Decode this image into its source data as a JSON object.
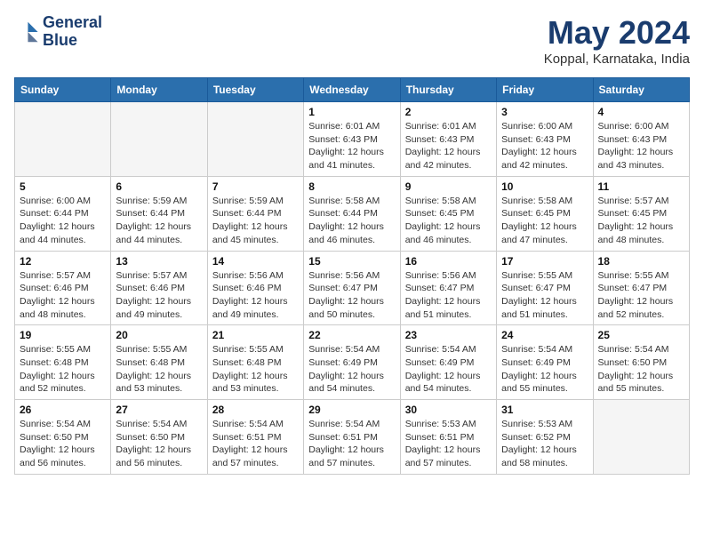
{
  "header": {
    "logo_line1": "General",
    "logo_line2": "Blue",
    "month_year": "May 2024",
    "location": "Koppal, Karnataka, India"
  },
  "days_of_week": [
    "Sunday",
    "Monday",
    "Tuesday",
    "Wednesday",
    "Thursday",
    "Friday",
    "Saturday"
  ],
  "weeks": [
    [
      {
        "day": "",
        "empty": true
      },
      {
        "day": "",
        "empty": true
      },
      {
        "day": "",
        "empty": true
      },
      {
        "day": "1",
        "sunrise": "6:01 AM",
        "sunset": "6:43 PM",
        "daylight": "12 hours and 41 minutes."
      },
      {
        "day": "2",
        "sunrise": "6:01 AM",
        "sunset": "6:43 PM",
        "daylight": "12 hours and 42 minutes."
      },
      {
        "day": "3",
        "sunrise": "6:00 AM",
        "sunset": "6:43 PM",
        "daylight": "12 hours and 42 minutes."
      },
      {
        "day": "4",
        "sunrise": "6:00 AM",
        "sunset": "6:43 PM",
        "daylight": "12 hours and 43 minutes."
      }
    ],
    [
      {
        "day": "5",
        "sunrise": "6:00 AM",
        "sunset": "6:44 PM",
        "daylight": "12 hours and 44 minutes."
      },
      {
        "day": "6",
        "sunrise": "5:59 AM",
        "sunset": "6:44 PM",
        "daylight": "12 hours and 44 minutes."
      },
      {
        "day": "7",
        "sunrise": "5:59 AM",
        "sunset": "6:44 PM",
        "daylight": "12 hours and 45 minutes."
      },
      {
        "day": "8",
        "sunrise": "5:58 AM",
        "sunset": "6:44 PM",
        "daylight": "12 hours and 46 minutes."
      },
      {
        "day": "9",
        "sunrise": "5:58 AM",
        "sunset": "6:45 PM",
        "daylight": "12 hours and 46 minutes."
      },
      {
        "day": "10",
        "sunrise": "5:58 AM",
        "sunset": "6:45 PM",
        "daylight": "12 hours and 47 minutes."
      },
      {
        "day": "11",
        "sunrise": "5:57 AM",
        "sunset": "6:45 PM",
        "daylight": "12 hours and 48 minutes."
      }
    ],
    [
      {
        "day": "12",
        "sunrise": "5:57 AM",
        "sunset": "6:46 PM",
        "daylight": "12 hours and 48 minutes."
      },
      {
        "day": "13",
        "sunrise": "5:57 AM",
        "sunset": "6:46 PM",
        "daylight": "12 hours and 49 minutes."
      },
      {
        "day": "14",
        "sunrise": "5:56 AM",
        "sunset": "6:46 PM",
        "daylight": "12 hours and 49 minutes."
      },
      {
        "day": "15",
        "sunrise": "5:56 AM",
        "sunset": "6:47 PM",
        "daylight": "12 hours and 50 minutes."
      },
      {
        "day": "16",
        "sunrise": "5:56 AM",
        "sunset": "6:47 PM",
        "daylight": "12 hours and 51 minutes."
      },
      {
        "day": "17",
        "sunrise": "5:55 AM",
        "sunset": "6:47 PM",
        "daylight": "12 hours and 51 minutes."
      },
      {
        "day": "18",
        "sunrise": "5:55 AM",
        "sunset": "6:47 PM",
        "daylight": "12 hours and 52 minutes."
      }
    ],
    [
      {
        "day": "19",
        "sunrise": "5:55 AM",
        "sunset": "6:48 PM",
        "daylight": "12 hours and 52 minutes."
      },
      {
        "day": "20",
        "sunrise": "5:55 AM",
        "sunset": "6:48 PM",
        "daylight": "12 hours and 53 minutes."
      },
      {
        "day": "21",
        "sunrise": "5:55 AM",
        "sunset": "6:48 PM",
        "daylight": "12 hours and 53 minutes."
      },
      {
        "day": "22",
        "sunrise": "5:54 AM",
        "sunset": "6:49 PM",
        "daylight": "12 hours and 54 minutes."
      },
      {
        "day": "23",
        "sunrise": "5:54 AM",
        "sunset": "6:49 PM",
        "daylight": "12 hours and 54 minutes."
      },
      {
        "day": "24",
        "sunrise": "5:54 AM",
        "sunset": "6:49 PM",
        "daylight": "12 hours and 55 minutes."
      },
      {
        "day": "25",
        "sunrise": "5:54 AM",
        "sunset": "6:50 PM",
        "daylight": "12 hours and 55 minutes."
      }
    ],
    [
      {
        "day": "26",
        "sunrise": "5:54 AM",
        "sunset": "6:50 PM",
        "daylight": "12 hours and 56 minutes."
      },
      {
        "day": "27",
        "sunrise": "5:54 AM",
        "sunset": "6:50 PM",
        "daylight": "12 hours and 56 minutes."
      },
      {
        "day": "28",
        "sunrise": "5:54 AM",
        "sunset": "6:51 PM",
        "daylight": "12 hours and 57 minutes."
      },
      {
        "day": "29",
        "sunrise": "5:54 AM",
        "sunset": "6:51 PM",
        "daylight": "12 hours and 57 minutes."
      },
      {
        "day": "30",
        "sunrise": "5:53 AM",
        "sunset": "6:51 PM",
        "daylight": "12 hours and 57 minutes."
      },
      {
        "day": "31",
        "sunrise": "5:53 AM",
        "sunset": "6:52 PM",
        "daylight": "12 hours and 58 minutes."
      },
      {
        "day": "",
        "empty": true
      }
    ]
  ]
}
